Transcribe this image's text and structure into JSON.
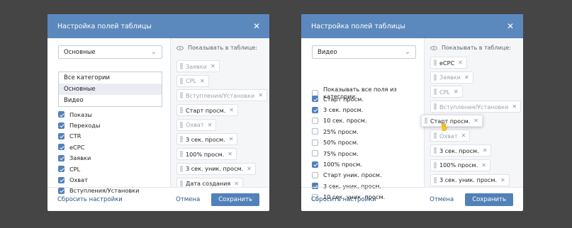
{
  "left": {
    "title": "Настройка полей таблицы",
    "select_value": "Основные",
    "dropdown_options": [
      {
        "label": "Все категории",
        "highlighted": false
      },
      {
        "label": "Основные",
        "highlighted": true
      },
      {
        "label": "Видео",
        "highlighted": false
      }
    ],
    "checkboxes": [
      {
        "label": "Показы",
        "checked": true
      },
      {
        "label": "Переходы",
        "checked": true
      },
      {
        "label": "CTR",
        "checked": true
      },
      {
        "label": "eCPC",
        "checked": true
      },
      {
        "label": "Заявки",
        "checked": true
      },
      {
        "label": "CPL",
        "checked": true
      },
      {
        "label": "Охват",
        "checked": true
      },
      {
        "label": "Вступления/Установки",
        "checked": true
      }
    ],
    "column_title": "Показывать в таблице:",
    "chips": [
      {
        "label": "Заявки",
        "dim": true
      },
      {
        "label": "CPL",
        "dim": true
      },
      {
        "label": "Вступления/Установки",
        "dim": true
      },
      {
        "label": "Старт просм.",
        "dim": false
      },
      {
        "label": "Охват",
        "dim": true
      },
      {
        "label": "3 сек. просм.",
        "dim": false
      },
      {
        "label": "100% просм.",
        "dim": false
      },
      {
        "label": "3 сек. уник. просм.",
        "dim": false
      },
      {
        "label": "Дата создания",
        "dim": false
      }
    ],
    "reset": "Сбросить настройки",
    "cancel": "Отмена",
    "save": "Сохранить"
  },
  "right": {
    "title": "Настройка полей таблицы",
    "select_value": "Видео",
    "show_all_label": "Показывать все поля из категории",
    "show_all_checked": false,
    "checkboxes": [
      {
        "label": "Старт просм.",
        "checked": true
      },
      {
        "label": "3 сек. просм.",
        "checked": true
      },
      {
        "label": "10 сек. просм.",
        "checked": false
      },
      {
        "label": "25% просм.",
        "checked": false
      },
      {
        "label": "50% просм.",
        "checked": false
      },
      {
        "label": "75% просм.",
        "checked": false
      },
      {
        "label": "100% просм.",
        "checked": true
      },
      {
        "label": "Старт уник. просм.",
        "checked": false
      },
      {
        "label": "3 сек. уник. просм.",
        "checked": true
      },
      {
        "label": "10 сек. уник. просм.",
        "checked": false
      }
    ],
    "column_title": "Показывать в таблице:",
    "chips": [
      {
        "label": "eCPC",
        "dim": false
      },
      {
        "label": "Заявки",
        "dim": true
      },
      {
        "label": "CPL",
        "dim": true
      },
      {
        "label": "Вступления/Установки",
        "dim": true
      },
      {
        "label": "",
        "gap": true
      },
      {
        "label": "Охват",
        "dim": true
      },
      {
        "label": "3 сек. просм.",
        "dim": false
      },
      {
        "label": "100% просм.",
        "dim": false
      },
      {
        "label": "3 сек. уник. просм.",
        "dim": false
      }
    ],
    "dragging_chip": "Старт просм.",
    "reset": "Сбросить настройки",
    "cancel": "Отмена",
    "save": "Сохранить"
  }
}
